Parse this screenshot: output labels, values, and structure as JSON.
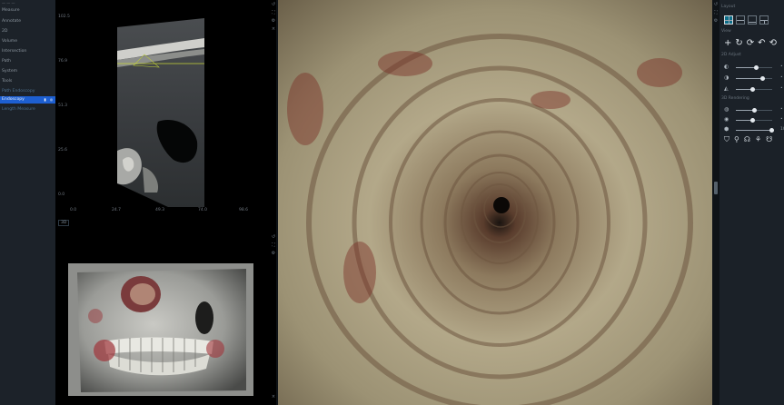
{
  "sidebar": {
    "items": [
      {
        "label": "Measure",
        "state": "normal"
      },
      {
        "label": "Annotate",
        "state": "normal"
      },
      {
        "label": "2D",
        "state": "normal"
      },
      {
        "label": "Volume",
        "state": "normal"
      },
      {
        "label": "Intersection",
        "state": "normal"
      },
      {
        "label": "Path",
        "state": "normal"
      },
      {
        "label": "System",
        "state": "normal"
      },
      {
        "label": "Tools",
        "state": "normal"
      },
      {
        "label": "Path Endoscopy",
        "state": "dim"
      },
      {
        "label": "Endoscopy",
        "state": "active"
      },
      {
        "label": "Length Measure",
        "state": "dim"
      }
    ]
  },
  "slice_view": {
    "y_ticks": [
      "102.5",
      "76.9",
      "51.3",
      "25.6",
      "0.0"
    ],
    "x_ticks": [
      "0.0",
      "24.7",
      "49.3",
      "74.0",
      "98.6"
    ]
  },
  "view3d": {
    "label": "3D"
  },
  "right_panel": {
    "sections": [
      "Layout",
      "View",
      "2D Adjust",
      "3D Rendering"
    ],
    "layout_buttons": [
      "layout-4up",
      "layout-1x2",
      "layout-2x1",
      "layout-1-2"
    ],
    "adjust_sliders": [
      {
        "icon": "contrast-icon",
        "value": 0.55
      },
      {
        "icon": "brightness-icon",
        "value": 0.7
      },
      {
        "icon": "gamma-icon",
        "value": 0.45
      }
    ],
    "render_sliders": [
      {
        "icon": "opacity-icon",
        "value": 0.5
      },
      {
        "icon": "light-icon",
        "value": 0.45
      },
      {
        "icon": "shading-icon",
        "value": 0.95,
        "label": "10"
      }
    ]
  },
  "colors": {
    "active": "#1d5fd1",
    "panel": "#1b2128",
    "layout_active": "#0d6f8a"
  }
}
